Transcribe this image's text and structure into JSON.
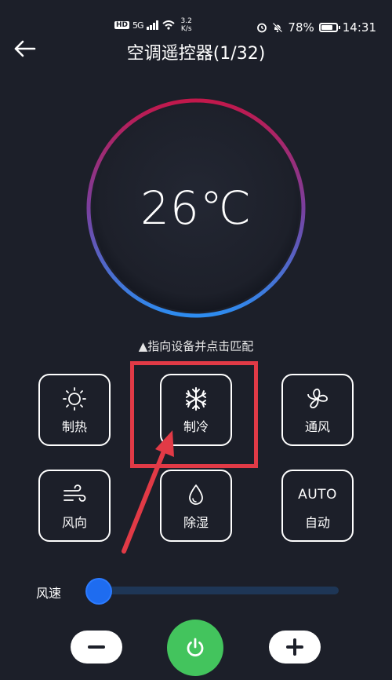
{
  "status_bar": {
    "hd": "HD",
    "network": "5G",
    "speed_value": "3.2",
    "speed_unit": "K/s",
    "battery": "78%",
    "battery_level": 0.78,
    "time": "14:31"
  },
  "header": {
    "title": "空调遥控器(1/32)"
  },
  "display": {
    "temperature": "26℃"
  },
  "hint": "▲指向设备并点击匹配",
  "modes": [
    {
      "label": "制热",
      "icon": "sun-icon"
    },
    {
      "label": "制冷",
      "icon": "snowflake-icon"
    },
    {
      "label": "通风",
      "icon": "fan-icon"
    },
    {
      "label": "风向",
      "icon": "wind-icon"
    },
    {
      "label": "除湿",
      "icon": "droplet-icon"
    },
    {
      "label": "自动",
      "icon_text": "AUTO"
    }
  ],
  "fan_speed": {
    "label": "风速",
    "level": 0.05
  },
  "colors": {
    "background": "#1c1f29",
    "ring_top": "#c2184b",
    "ring_bottom": "#2d8cf0",
    "highlight": "#e13a46",
    "power": "#43c45d",
    "slider_thumb": "#1e6cf0"
  }
}
